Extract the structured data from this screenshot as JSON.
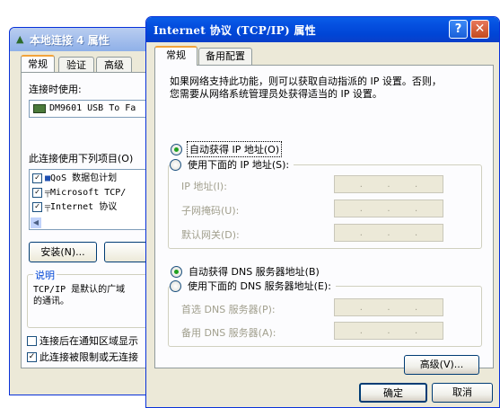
{
  "back_window": {
    "title": "本地连接 4 属性",
    "tabs": [
      "常规",
      "验证",
      "高级"
    ],
    "connect_using_label": "连接时使用:",
    "adapter_name": "DM9601 USB To Fa",
    "components_label": "此连接使用下列项目(O)",
    "components": [
      {
        "label": "QoS 数据包计划",
        "checked": true,
        "icon": "qos-icon"
      },
      {
        "label": "Microsoft TCP/",
        "checked": true,
        "icon": "network-icon"
      },
      {
        "label": "Internet 协议",
        "checked": true,
        "icon": "network-icon"
      }
    ],
    "install_button": "安装(N)...",
    "description_legend": "说明",
    "description_text": "TCP/IP 是默认的广域\n的通讯。",
    "checkbox_notify": "连接后在通知区域显示",
    "checkbox_notify_checked": false,
    "checkbox_limited": "此连接被限制或无连接",
    "checkbox_limited_checked": true
  },
  "dialog": {
    "title": "Internet 协议 (TCP/IP) 属性",
    "help_glyph": "?",
    "close_glyph": "✕",
    "tabs": {
      "general": "常规",
      "alternate": "备用配置"
    },
    "intro_text": "如果网络支持此功能，则可以获取自动指派的 IP 设置。否则，\n您需要从网络系统管理员处获得适当的 IP 设置。",
    "ip_mode": {
      "auto_label": "自动获得 IP 地址(O)",
      "auto_selected": true,
      "manual_label": "使用下面的 IP 地址(S):",
      "manual_selected": false
    },
    "ip_fields": {
      "ip_address_label": "IP 地址(I):",
      "subnet_label": "子网掩码(U):",
      "gateway_label": "默认网关(D):"
    },
    "dns_mode": {
      "auto_label": "自动获得 DNS 服务器地址(B)",
      "auto_selected": true,
      "manual_label": "使用下面的 DNS 服务器地址(E):",
      "manual_selected": false
    },
    "dns_fields": {
      "preferred_label": "首选 DNS 服务器(P):",
      "alternate_label": "备用 DNS 服务器(A):"
    },
    "advanced_button": "高级(V)...",
    "ok_button": "确定",
    "cancel_button": "取消"
  }
}
